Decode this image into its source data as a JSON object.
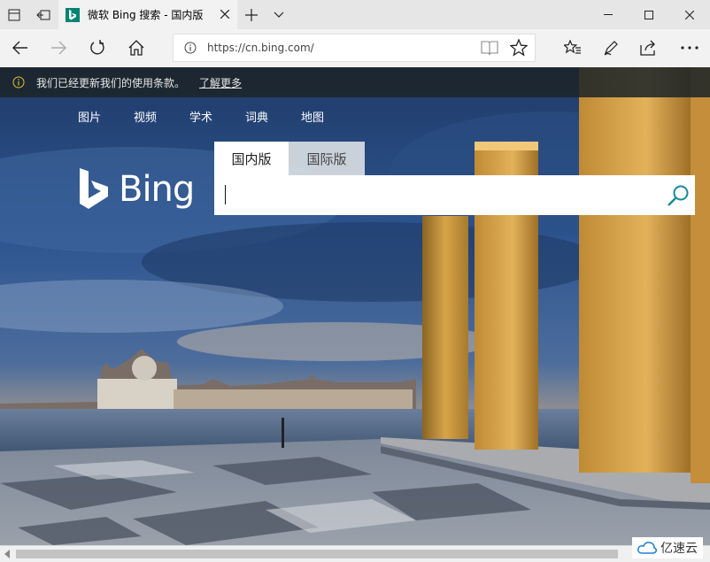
{
  "tab": {
    "title": "微软 Bing 搜索 - 国内版"
  },
  "address": {
    "url": "https://cn.bing.com/"
  },
  "notice": {
    "text": "我们已经更新我们的使用条款。",
    "link": "了解更多"
  },
  "bing": {
    "nav": [
      "图片",
      "视频",
      "学术",
      "词典",
      "地图"
    ],
    "logo_text": "Bing",
    "tabs": [
      "国内版",
      "国际版"
    ],
    "search_value": ""
  },
  "watermark": {
    "text": "亿速云"
  },
  "colors": {
    "bing_teal": "#008373",
    "search_icon": "#1a8a9a"
  }
}
